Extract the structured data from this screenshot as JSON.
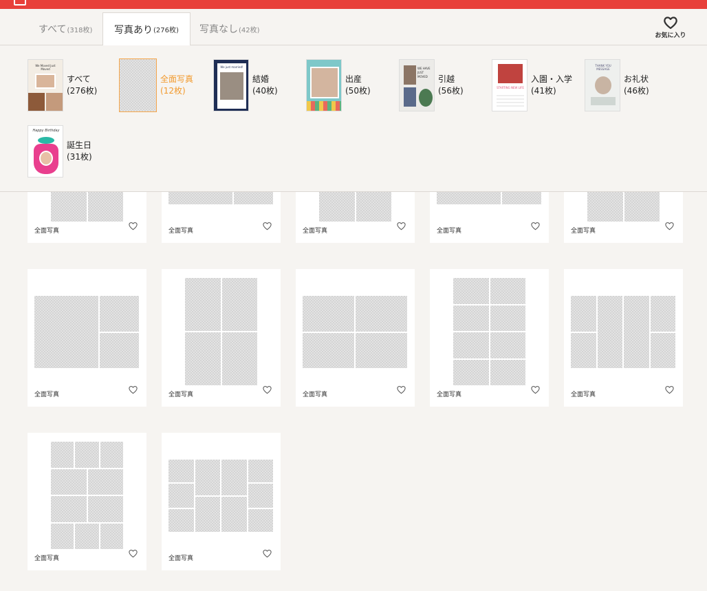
{
  "tabs": {
    "all": {
      "label": "すべて",
      "count": "(318枚)"
    },
    "with_photo": {
      "label": "写真あり",
      "count": "(276枚)"
    },
    "no_photo": {
      "label": "写真なし",
      "count": "(42枚)"
    }
  },
  "favorites": {
    "label": "お気に入り",
    "icon": "heart-icon"
  },
  "categories": [
    {
      "name": "すべて",
      "count": "(276枚)"
    },
    {
      "name": "全面写真",
      "count": "(12枚)"
    },
    {
      "name": "結婚",
      "count": "(40枚)"
    },
    {
      "name": "出産",
      "count": "(50枚)"
    },
    {
      "name": "引越",
      "count": "(56枚)"
    },
    {
      "name": "入園・入学",
      "count": "(41枚)"
    },
    {
      "name": "お礼状",
      "count": "(46枚)"
    },
    {
      "name": "誕生日",
      "count": "(31枚)"
    }
  ],
  "thumb_texts": {
    "all": "We Moved Just Moved",
    "wedding": "We just married!",
    "moving": "WE HAVE JUST MOVED",
    "school": "STARTING NEW LIFE",
    "thanks": "THANK YOU MESSAGE",
    "birthday": "Happy Birthday"
  },
  "card_label": "全面写真",
  "colors": {
    "accent": "#e8403a",
    "active": "#f29a2e"
  }
}
